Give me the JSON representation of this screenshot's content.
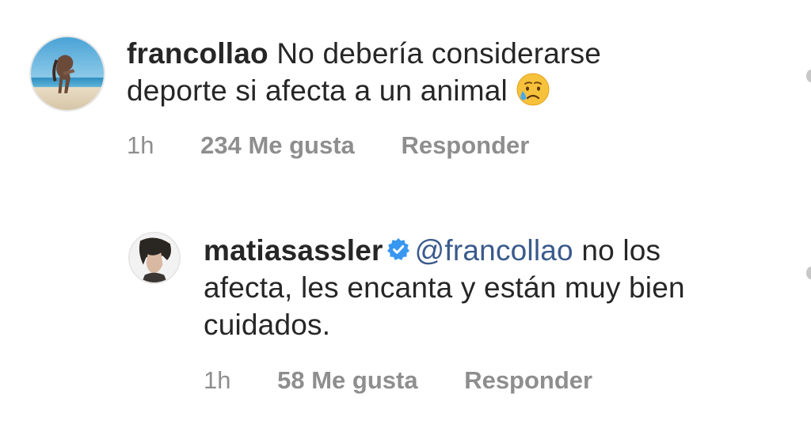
{
  "comments": [
    {
      "username": "francollao",
      "text": "No debería considerarse deporte si afecta a un animal",
      "emoji": "sad-but-relieved-face-emoji",
      "time": "1h",
      "likes": "234 Me gusta",
      "reply_label": "Responder",
      "avatar": "beach-photo-avatar"
    },
    {
      "username": "matiasassler",
      "verified": true,
      "mention": "@francollao",
      "text": "no los afecta, les encanta y están muy bien cuidados.",
      "time": "1h",
      "likes": "58 Me gusta",
      "reply_label": "Responder",
      "avatar": "portrait-avatar"
    }
  ],
  "colors": {
    "text": "#262626",
    "meta": "#8e8e8e",
    "mention": "#3a5a8c",
    "verified": "#3897f0"
  }
}
